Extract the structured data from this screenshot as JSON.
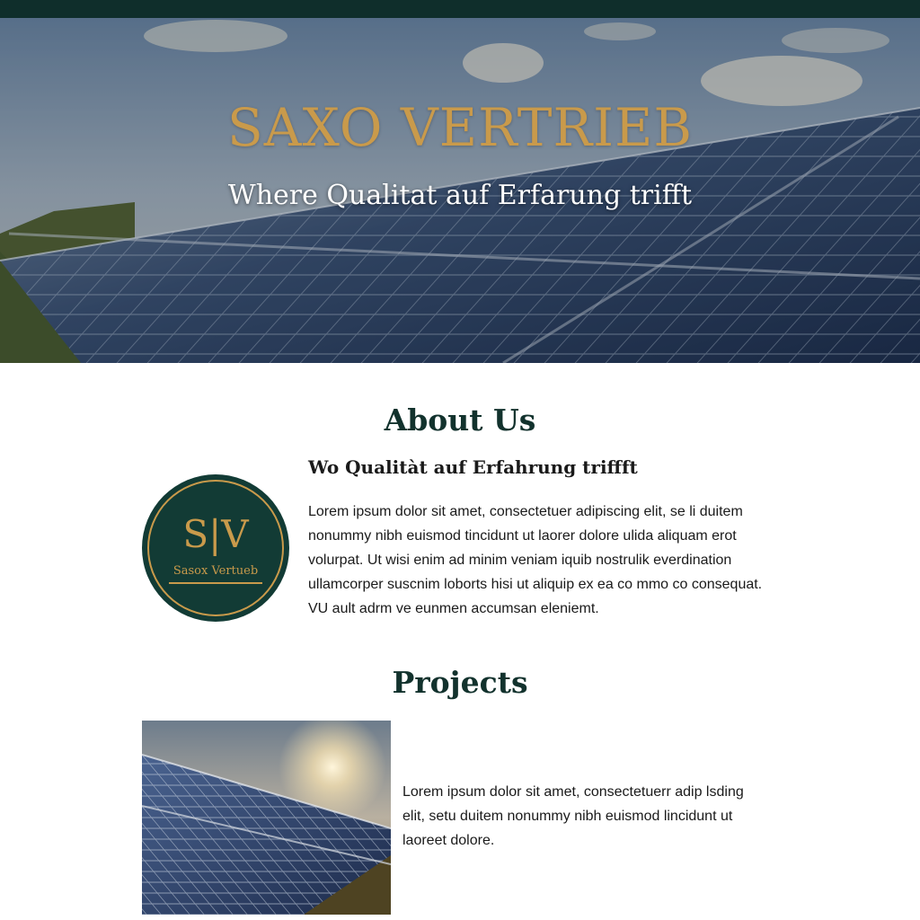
{
  "hero": {
    "title": "SAXO VERTRIEB",
    "subtitle": "Where Qualitat auf Erfarung trifft",
    "image": "solar-panels-field-photo"
  },
  "about": {
    "heading": "About Us",
    "subheading": "Wo Qualitàt auf Erfahrung triffft",
    "logo": {
      "monogram": "S|V",
      "name": "Sasox Vertueb"
    },
    "body": "Lorem ipsum dolor sit amet, consectetuer adipiscing elit, se li duitem nonummy nibh euismod tincidunt ut laorer dolore ulida aliquam erot volurpat. Ut wisi enim ad minim veniam iquib nostrulik everdination ullamcorper suscnim loborts hisi ut aliquip ex ea co mmo co  consequat. VU ault adrm ve eunmen accumsan eleniemt."
  },
  "projects": {
    "heading": "Projects",
    "image": "solar-panels-sunset-photo",
    "text": "Lorem ipsum dolor sit amet, consectetuerr adip lsding elit, setu duitem nonummy nibh euismod lincidunt ut laoreet dolore."
  },
  "colors": {
    "topbar": "#0f2e2b",
    "gold": "#c99a4b",
    "heading": "#12322d",
    "logo_bg": "#123b35"
  }
}
